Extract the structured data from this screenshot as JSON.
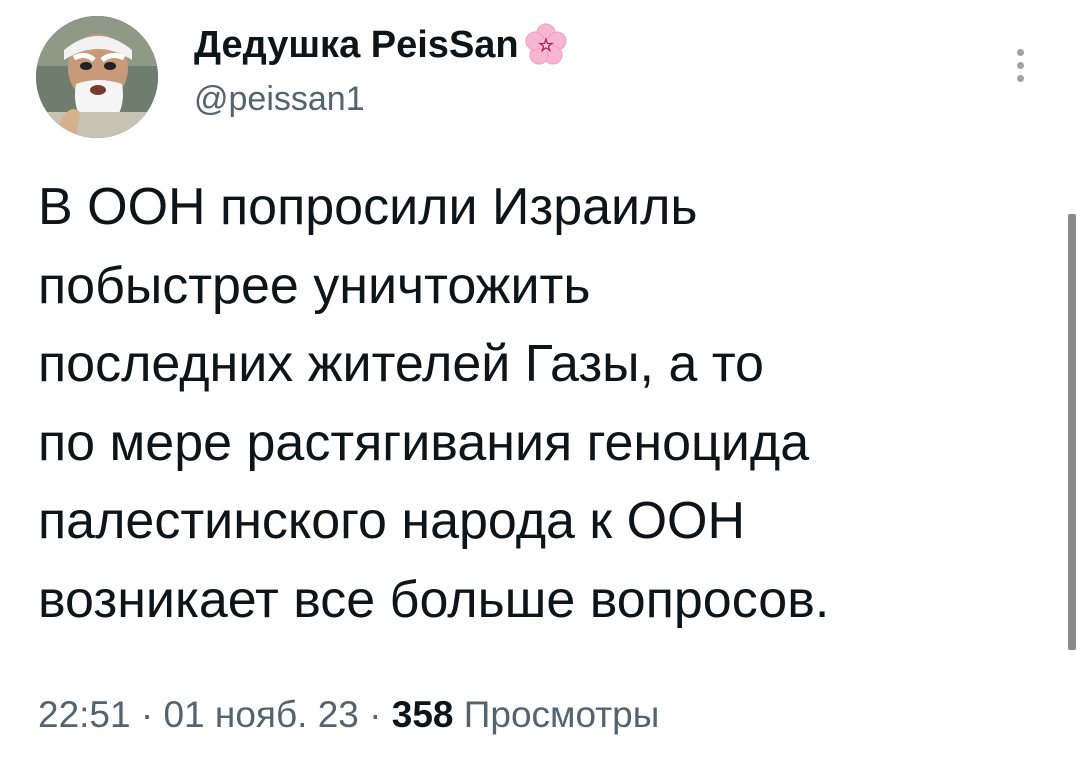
{
  "user": {
    "display_name": "Дедушка PeisSan",
    "handle": "@peissan1",
    "avatar_icon": "avatar-old-man-white-beard",
    "name_emoji_icon": "cherry-blossom-icon"
  },
  "tweet": {
    "text_lines": [
      "В ООН попросили Израиль",
      "побыстрее уничтожить",
      "последних жителей Газы, а то",
      "по мере растягивания геноцида",
      "палестинского народа к ООН",
      "возникает все больше вопросов."
    ]
  },
  "meta": {
    "time": "22:51",
    "separator": " · ",
    "date": "01 нояб. 23",
    "views_count": "358",
    "views_label": "Просмотры"
  },
  "actions": {
    "more_icon": "more-vertical-icon"
  },
  "colors": {
    "text": "#0f1419",
    "secondary": "#536471",
    "flower": "#f7b6d2"
  }
}
